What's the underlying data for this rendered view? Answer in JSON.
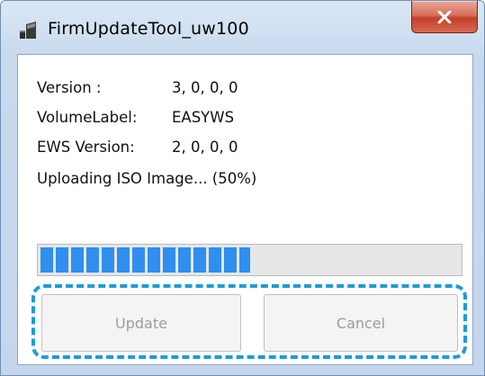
{
  "window": {
    "title": "FirmUpdateTool_uw100",
    "close_icon": "close-icon",
    "app_icon": "firm-update-tool-icon"
  },
  "info": {
    "version_label": "Version :",
    "version_value": "3, 0, 0, 0",
    "volume_label_label": "VolumeLabel:",
    "volume_label_value": "EASYWS",
    "ews_version_label": "EWS Version:",
    "ews_version_value": "2, 0, 0, 0"
  },
  "status": {
    "text": "Uploading ISO Image... (50%)"
  },
  "progress": {
    "percent": 50,
    "color": "#2f8fee"
  },
  "buttons": {
    "update_label": "Update",
    "cancel_label": "Cancel",
    "enabled": false
  },
  "highlight": {
    "color": "#1f9bd8",
    "style": "dashed"
  }
}
